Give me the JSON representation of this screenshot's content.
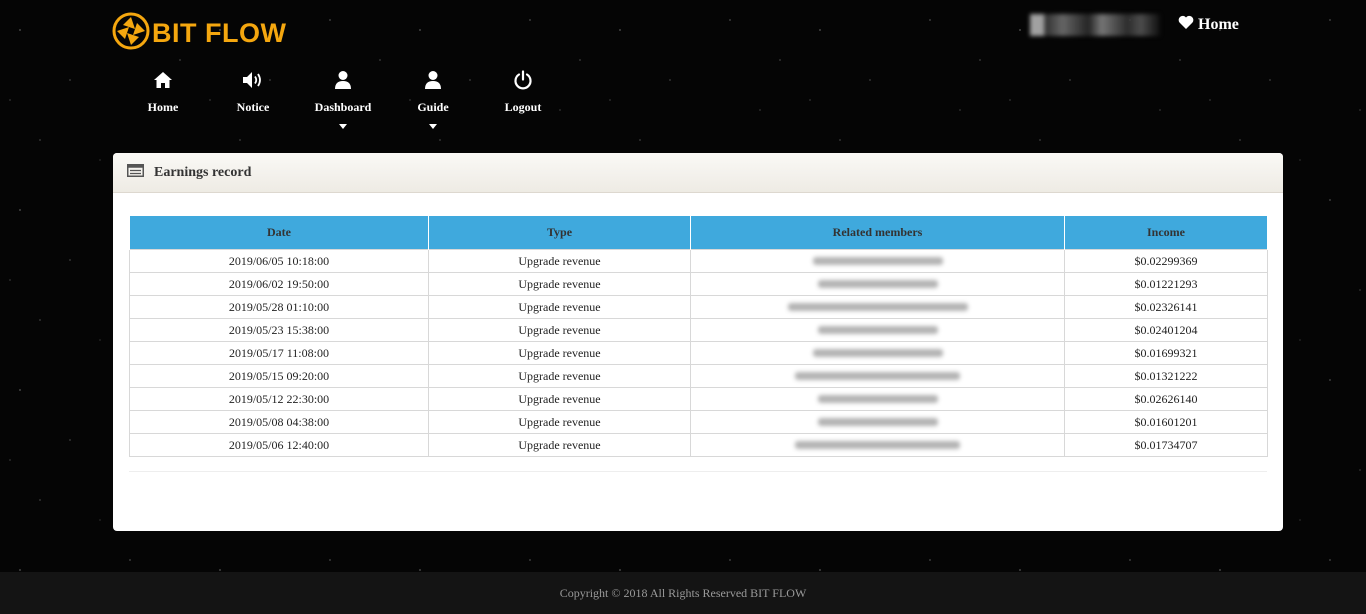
{
  "brand": {
    "name": "BIT FLOW",
    "color": "#f5a70f"
  },
  "header": {
    "home_link": "Home"
  },
  "nav": [
    {
      "label": "Home",
      "icon": "home-icon",
      "caret": false
    },
    {
      "label": "Notice",
      "icon": "speaker-icon",
      "caret": false
    },
    {
      "label": "Dashboard",
      "icon": "user-icon",
      "caret": true
    },
    {
      "label": "Guide",
      "icon": "user-icon",
      "caret": true
    },
    {
      "label": "Logout",
      "icon": "power-icon",
      "caret": false
    }
  ],
  "panel": {
    "title": "Earnings record",
    "columns": [
      "Date",
      "Type",
      "Related members",
      "Income"
    ],
    "rows": [
      {
        "date": "2019/06/05 10:18:00",
        "type": "Upgrade revenue",
        "member_width": 130,
        "income": "$0.02299369"
      },
      {
        "date": "2019/06/02 19:50:00",
        "type": "Upgrade revenue",
        "member_width": 120,
        "income": "$0.01221293"
      },
      {
        "date": "2019/05/28 01:10:00",
        "type": "Upgrade revenue",
        "member_width": 180,
        "income": "$0.02326141"
      },
      {
        "date": "2019/05/23 15:38:00",
        "type": "Upgrade revenue",
        "member_width": 120,
        "income": "$0.02401204"
      },
      {
        "date": "2019/05/17 11:08:00",
        "type": "Upgrade revenue",
        "member_width": 130,
        "income": "$0.01699321"
      },
      {
        "date": "2019/05/15 09:20:00",
        "type": "Upgrade revenue",
        "member_width": 165,
        "income": "$0.01321222"
      },
      {
        "date": "2019/05/12 22:30:00",
        "type": "Upgrade revenue",
        "member_width": 120,
        "income": "$0.02626140"
      },
      {
        "date": "2019/05/08 04:38:00",
        "type": "Upgrade revenue",
        "member_width": 120,
        "income": "$0.01601201"
      },
      {
        "date": "2019/05/06 12:40:00",
        "type": "Upgrade revenue",
        "member_width": 165,
        "income": "$0.01734707"
      }
    ]
  },
  "footer": {
    "copyright": "Copyright © 2018 All Rights Reserved BIT FLOW"
  },
  "colors": {
    "table_header": "#3fa9dd",
    "background": "#050505",
    "footer_bg": "#141414"
  }
}
